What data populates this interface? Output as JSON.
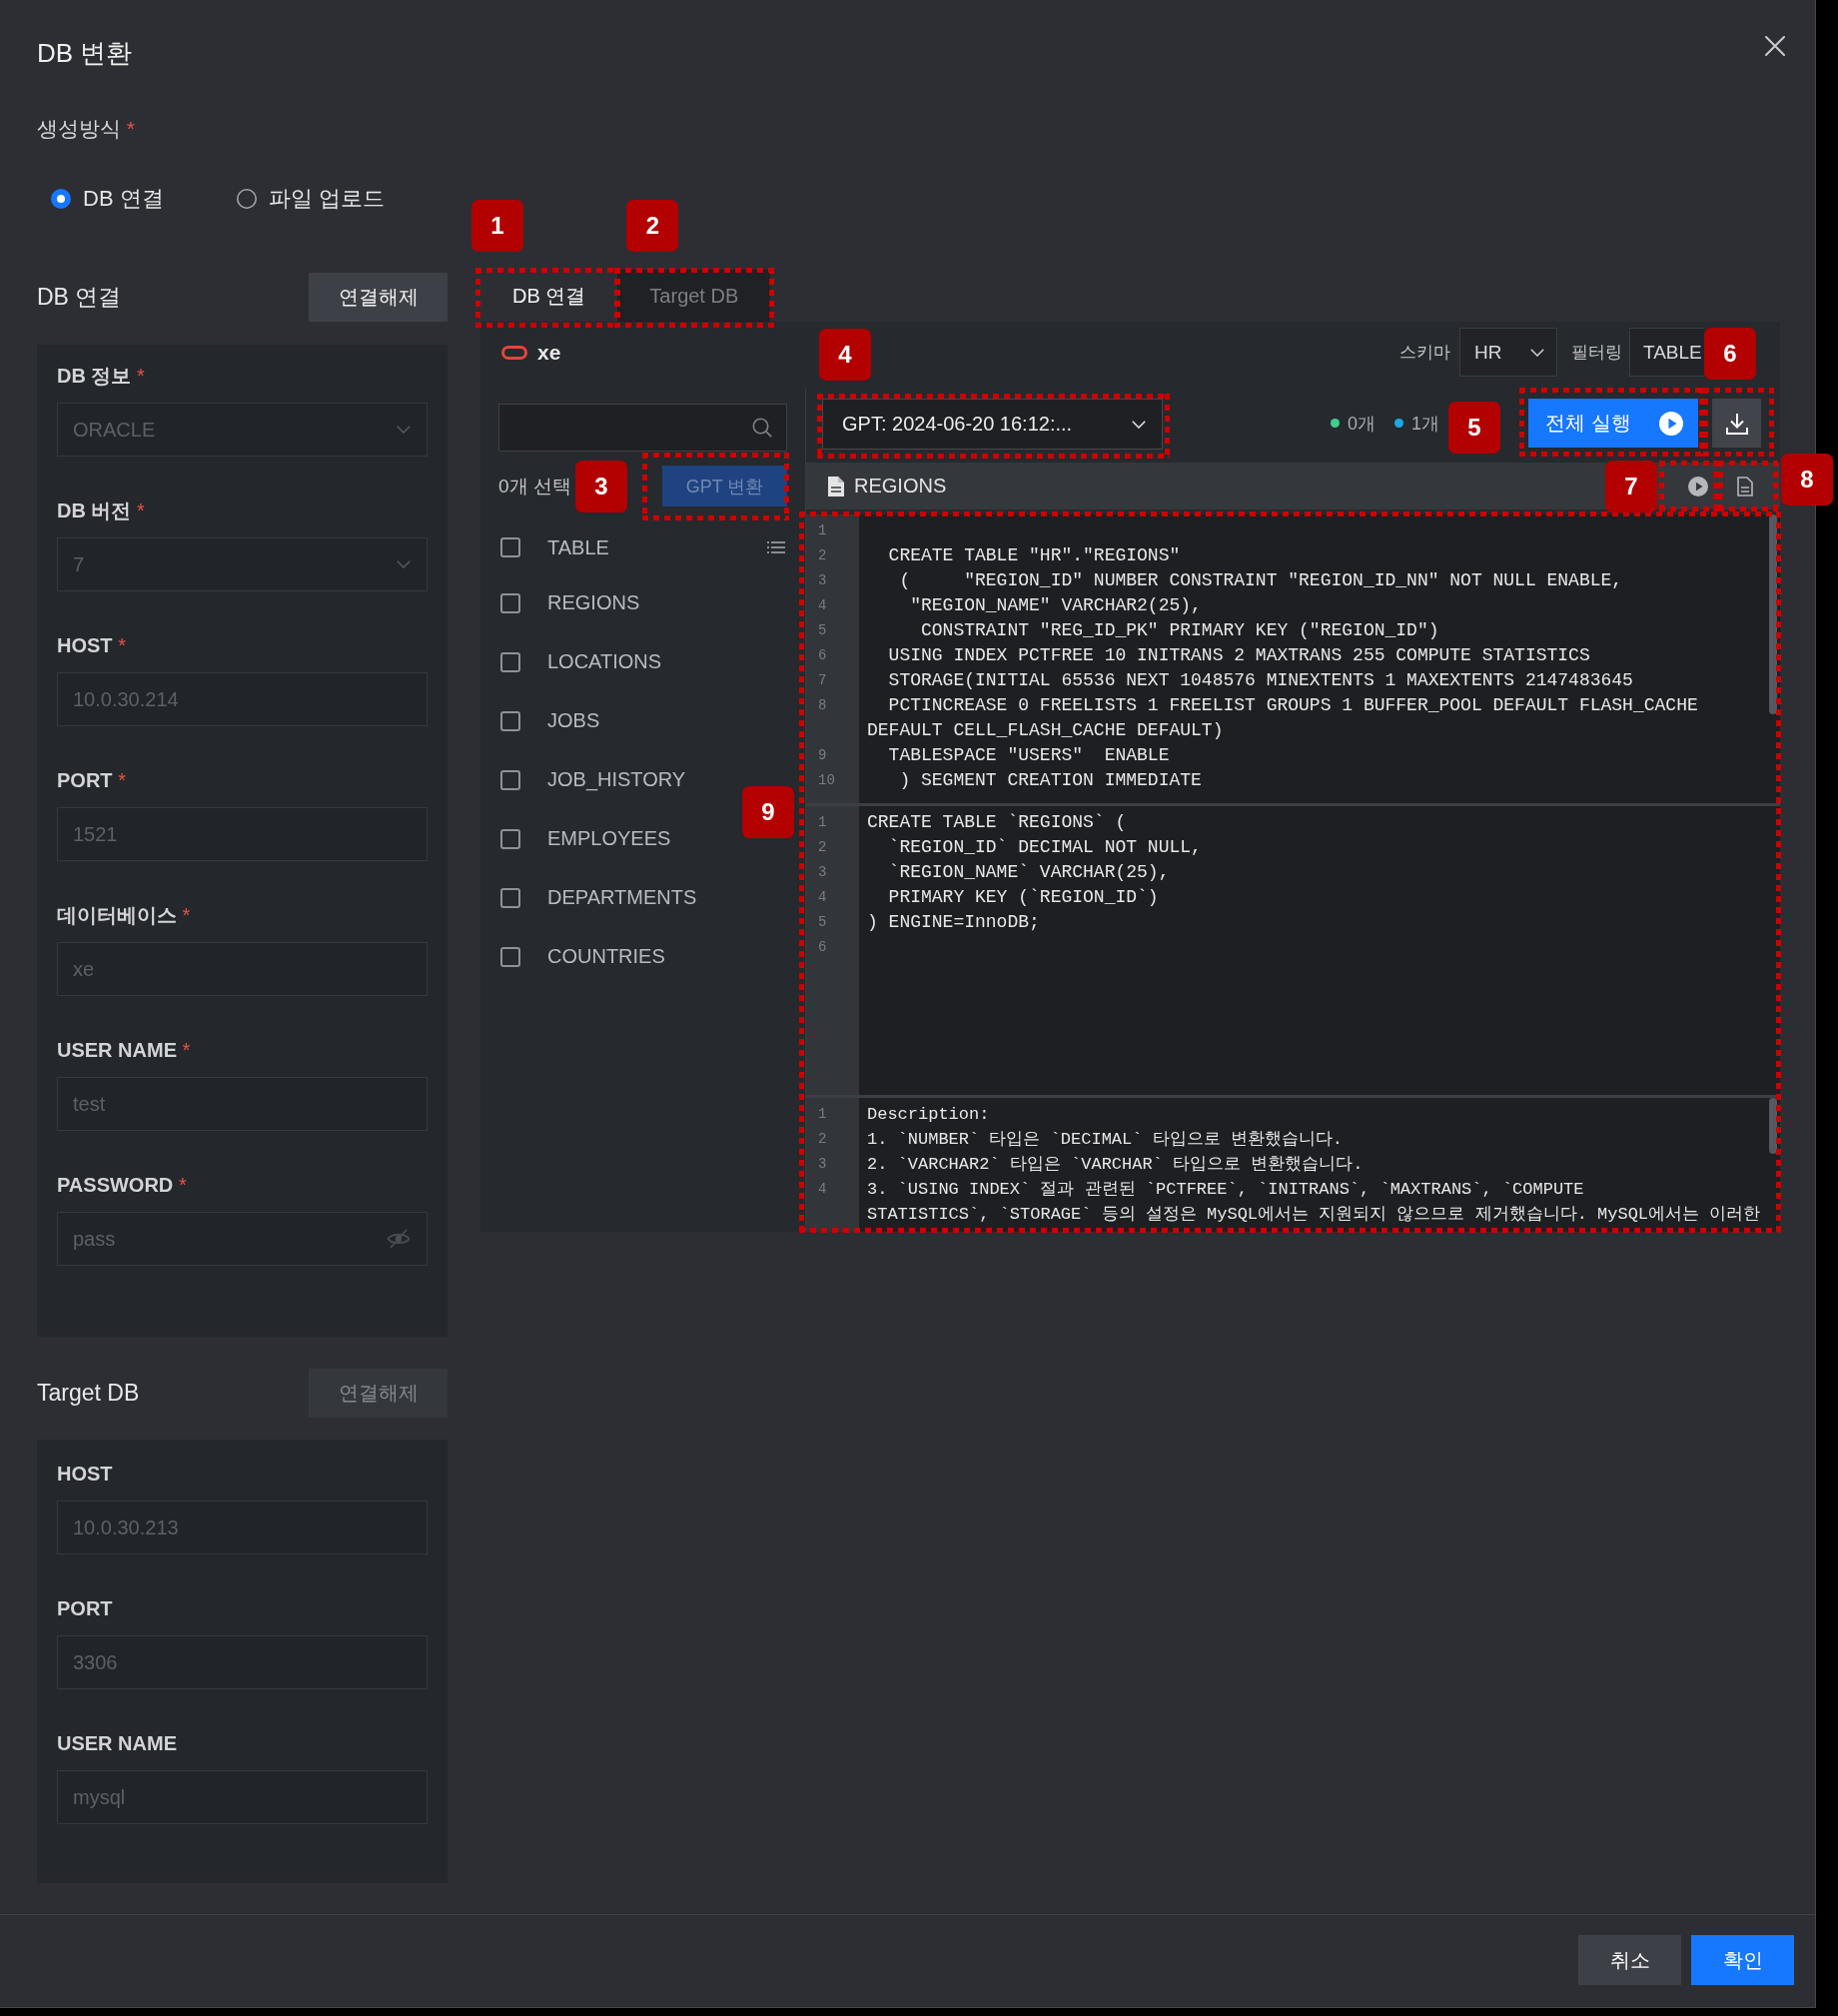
{
  "dialog": {
    "title": "DB 변환"
  },
  "creation_method": {
    "label": "생성방식",
    "marker": "*",
    "options": [
      {
        "label": "DB 연결",
        "selected": true
      },
      {
        "label": "파일 업로드",
        "selected": false
      }
    ]
  },
  "source_db": {
    "heading": "DB 연결",
    "disconnect_button": {
      "label": "연결해제",
      "disabled": false
    },
    "fields": [
      {
        "label": "DB 정보",
        "marker": "*",
        "kind": "select",
        "value": "ORACLE",
        "disabled": true
      },
      {
        "label": "DB 버전",
        "marker": "*",
        "kind": "select",
        "value": "7",
        "disabled": true
      },
      {
        "label": "HOST",
        "marker": "*",
        "kind": "text",
        "value": "10.0.30.214",
        "disabled": true
      },
      {
        "label": "PORT",
        "marker": "*",
        "kind": "text",
        "value": "1521",
        "disabled": true
      },
      {
        "label": "데이터베이스",
        "marker": "*",
        "kind": "text",
        "value": "xe",
        "disabled": true
      },
      {
        "label": "USER NAME",
        "marker": "*",
        "kind": "text",
        "value": "test",
        "disabled": true
      },
      {
        "label": "PASSWORD",
        "marker": "*",
        "kind": "password",
        "value": "pass",
        "disabled": true
      }
    ]
  },
  "target_db": {
    "heading": "Target DB",
    "disconnect_button": {
      "label": "연결해제",
      "disabled": true
    },
    "fields": [
      {
        "label": "HOST",
        "kind": "text",
        "value": "10.0.30.213",
        "disabled": true
      },
      {
        "label": "PORT",
        "kind": "text",
        "value": "3306",
        "disabled": true
      },
      {
        "label": "USER NAME",
        "kind": "text",
        "value": "mysql",
        "disabled": true
      }
    ]
  },
  "workspace": {
    "tabs": [
      {
        "label": "DB 연결",
        "selected": true,
        "callout": "1"
      },
      {
        "label": "Target DB",
        "selected": false,
        "callout": "2"
      }
    ],
    "connection": {
      "name": "xe"
    },
    "schema": {
      "label": "스키마",
      "value": "HR"
    },
    "filter": {
      "label": "필터링",
      "value": "TABLE"
    },
    "object_list": {
      "selected_count": "0개 선택",
      "convert_button": {
        "label": "GPT 변환",
        "disabled": true,
        "callout": "3"
      },
      "header": {
        "label": "TABLE",
        "checked": false
      },
      "items": [
        {
          "label": "REGIONS",
          "checked": false
        },
        {
          "label": "LOCATIONS",
          "checked": false
        },
        {
          "label": "JOBS",
          "checked": false
        },
        {
          "label": "JOB_HISTORY",
          "checked": false
        },
        {
          "label": "EMPLOYEES",
          "checked": false
        },
        {
          "label": "DEPARTMENTS",
          "checked": false
        },
        {
          "label": "COUNTRIES",
          "checked": false
        }
      ]
    },
    "toolbar": {
      "version_select": {
        "value": "GPT: 2024-06-20 16:12:...",
        "callout": "4"
      },
      "status_counts": [
        {
          "label": "0개",
          "color": "#3ecf8e"
        },
        {
          "label": "1개",
          "color": "#1ea7e4"
        }
      ],
      "run_all_button": {
        "label": "전체 실행",
        "callout": "5"
      },
      "download_button": {
        "callout": "6"
      }
    },
    "script": {
      "title": "REGIONS",
      "run_button": {
        "callout": "7"
      },
      "document_button": {
        "callout": "8"
      }
    },
    "editors": {
      "callout": "9",
      "panes": [
        {
          "kind": "source",
          "scrollbar": true,
          "lines": [
            {
              "number": "1"
            },
            {
              "number": "2",
              "segments": [
                "  CREATE TABLE \"HR\".\"REGIONS\""
              ]
            },
            {
              "number": "3",
              "segments": [
                "   (     \"REGION_ID\" NUMBER CONSTRAINT \"REGION_ID_NN\" NOT NULL ENABLE,"
              ]
            },
            {
              "number": "4",
              "segments": [
                "    \"REGION_NAME\" VARCHAR2(25),"
              ]
            },
            {
              "number": "5",
              "segments": [
                "     CONSTRAINT \"REG_ID_PK\" PRIMARY KEY (\"REGION_ID\")"
              ]
            },
            {
              "number": "6",
              "segments": [
                "  USING INDEX PCTFREE 10 INITRANS 2 MAXTRANS 255 COMPUTE STATISTICS"
              ]
            },
            {
              "number": "7",
              "segments": [
                "  STORAGE(INITIAL 65536 NEXT 1048576 MINEXTENTS 1 MAXEXTENTS 2147483645"
              ]
            },
            {
              "number": "8",
              "segments": [
                "  PCTINCREASE 0 FREELISTS 1 FREELIST GROUPS 1 BUFFER_POOL DEFAULT FLASH_CACHE",
                "DEFAULT CELL_FLASH_CACHE DEFAULT)"
              ]
            },
            {
              "number": "9",
              "segments": [
                "  TABLESPACE \"USERS\"  ENABLE"
              ]
            },
            {
              "number": "10",
              "segments": [
                "   ) SEGMENT CREATION IMMEDIATE"
              ]
            }
          ]
        },
        {
          "kind": "target",
          "scrollbar": false,
          "lines": [
            {
              "number": "1",
              "segments": [
                "CREATE TABLE `REGIONS` ("
              ]
            },
            {
              "number": "2",
              "segments": [
                "  `REGION_ID` DECIMAL NOT NULL,"
              ]
            },
            {
              "number": "3",
              "segments": [
                "  `REGION_NAME` VARCHAR(25),"
              ]
            },
            {
              "number": "4",
              "segments": [
                "  PRIMARY KEY (`REGION_ID`)"
              ]
            },
            {
              "number": "5",
              "segments": [
                ") ENGINE=InnoDB;"
              ]
            },
            {
              "number": "6"
            }
          ]
        },
        {
          "kind": "description",
          "scrollbar": true,
          "lines": [
            {
              "number": "1",
              "segments": [
                "Description:"
              ]
            },
            {
              "number": "2",
              "segments": [
                "1. `NUMBER` 타입은 `DECIMAL` 타입으로 변환했습니다."
              ]
            },
            {
              "number": "3",
              "segments": [
                "2. `VARCHAR2` 타입은 `VARCHAR` 타입으로 변환했습니다."
              ]
            },
            {
              "number": "4",
              "segments": [
                "3. `USING INDEX` 절과 관련된 `PCTFREE`, `INITRANS`, `MAXTRANS`, `COMPUTE",
                "STATISTICS`, `STORAGE` 등의 설정은 MySQL에서는 지원되지 않으므로 제거했습니다. MySQL에서는 이러한"
              ]
            }
          ]
        }
      ]
    }
  },
  "footer": {
    "buttons": [
      {
        "label": "취소",
        "kind": "secondary"
      },
      {
        "label": "확인",
        "kind": "primary"
      }
    ]
  }
}
